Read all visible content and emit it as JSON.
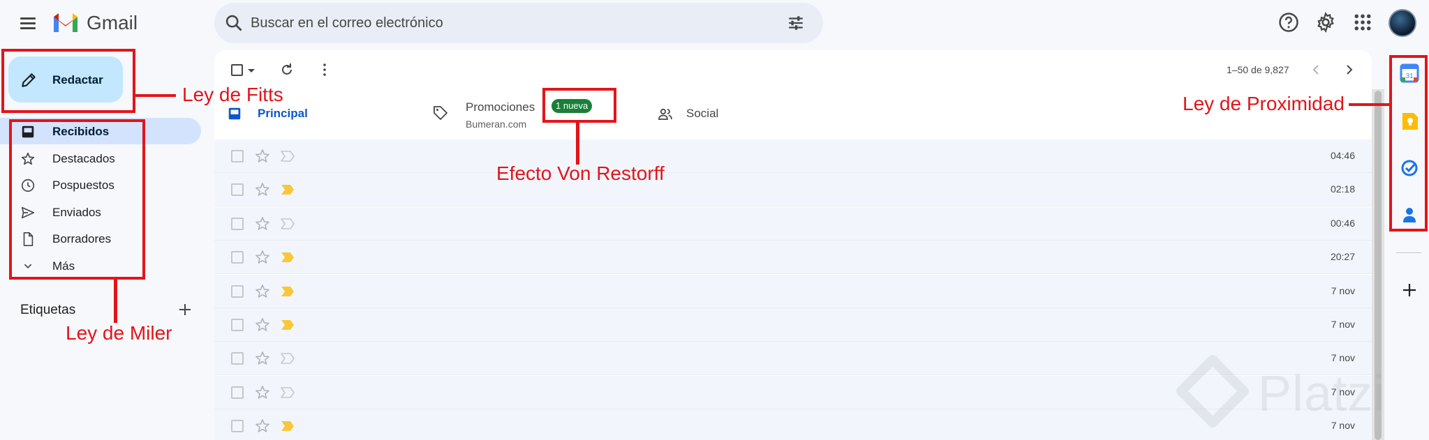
{
  "app": {
    "name": "Gmail"
  },
  "search": {
    "placeholder": "Buscar en el correo electrónico"
  },
  "compose": {
    "label": "Redactar"
  },
  "sidebar": {
    "items": [
      {
        "label": "Recibidos",
        "icon": "inbox-icon",
        "active": true
      },
      {
        "label": "Destacados",
        "icon": "star-icon"
      },
      {
        "label": "Pospuestos",
        "icon": "clock-icon"
      },
      {
        "label": "Enviados",
        "icon": "send-icon"
      },
      {
        "label": "Borradores",
        "icon": "draft-icon"
      },
      {
        "label": "Más",
        "icon": "chevron-down-icon"
      }
    ],
    "labels_header": "Etiquetas"
  },
  "toolbar": {
    "pagination": "1–50 de 9,827"
  },
  "tabs": [
    {
      "label": "Principal",
      "icon": "inbox-icon",
      "active": true
    },
    {
      "label": "Promociones",
      "icon": "tag-icon",
      "subtitle": "Bumeran.com",
      "badge": "1 nueva"
    },
    {
      "label": "Social",
      "icon": "people-icon"
    }
  ],
  "emails": [
    {
      "time": "04:46",
      "important": false
    },
    {
      "time": "02:18",
      "important": true
    },
    {
      "time": "00:46",
      "important": false
    },
    {
      "time": "20:27",
      "important": true
    },
    {
      "time": "7 nov",
      "important": true
    },
    {
      "time": "7 nov",
      "important": true
    },
    {
      "time": "7 nov",
      "important": false
    },
    {
      "time": "7 nov",
      "important": false
    },
    {
      "time": "7 nov",
      "important": true
    }
  ],
  "side_panel": [
    {
      "icon": "calendar-icon",
      "label": "31"
    },
    {
      "icon": "keep-icon"
    },
    {
      "icon": "tasks-icon"
    },
    {
      "icon": "contacts-icon"
    }
  ],
  "annotations": {
    "fitts": "Ley de Fitts",
    "miller": "Ley de Miler",
    "restorff": "Efecto Von Restorff",
    "proximity": "Ley de Proximidad"
  },
  "watermark": "Platzi",
  "colors": {
    "annotation": "#e3141a",
    "accent": "#0b57d0",
    "compose_bg": "#c2e7ff",
    "active_nav": "#d3e3fd",
    "badge": "#188038",
    "important": "#f9c73b"
  }
}
